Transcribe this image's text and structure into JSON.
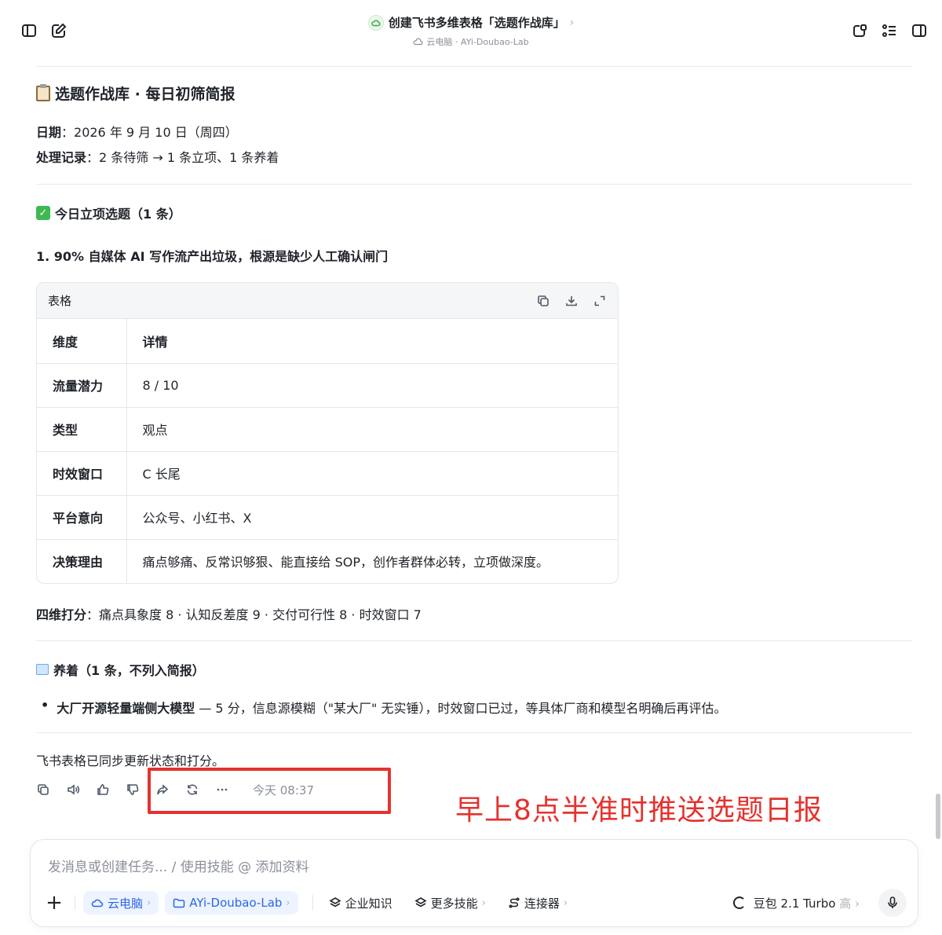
{
  "header": {
    "title": "创建飞书多维表格「选题作战库」",
    "title_chevron": "›",
    "subtitle": "云电脑 · AYi-Doubao-Lab"
  },
  "report": {
    "title": "选题作战库 · 每日初筛简报",
    "date_label": "日期",
    "date_value": "：2026 年 9 月 10 日（周四）",
    "record_label": "处理记录",
    "record_value": "：2 条待筛 → 1 条立项、1 条养着"
  },
  "approved": {
    "heading": "今日立项选题（1 条）",
    "item_title": "1. 90% 自媒体 AI 写作流产出垃圾，根源是缺少人工确认闸门",
    "table_label": "表格",
    "rows": [
      {
        "k": "维度",
        "v": "详情",
        "header": true
      },
      {
        "k": "流量潜力",
        "v": "8 / 10"
      },
      {
        "k": "类型",
        "v": "观点"
      },
      {
        "k": "时效窗口",
        "v": "C 长尾"
      },
      {
        "k": "平台意向",
        "v": "公众号、小红书、X"
      },
      {
        "k": "决策理由",
        "v": "痛点够痛、反常识够狠、能直接给 SOP，创作者群体必转，立项做深度。"
      }
    ],
    "score_label": "四维打分",
    "score_value": "：痛点具象度 8 · 认知反差度 9 · 交付可行性 8 · 时效窗口 7"
  },
  "incubating": {
    "heading": "养着（1 条，不列入简报）",
    "bullet_bold": "大厂开源轻量端侧大模型",
    "bullet_rest": " — 5 分，信息源模糊（\"某大厂\" 无实锤），时效窗口已过，等具体厂商和模型名明确后再评估。"
  },
  "footer_note": "飞书表格已同步更新状态和打分。",
  "actions": {
    "time": "今天 08:37"
  },
  "annotation": "早上8点半准时推送选题日报",
  "input": {
    "placeholder": "发消息或创建任务... / 使用技能 @ 添加资料",
    "chips": {
      "cloud": "云电脑",
      "lab": "AYi-Doubao-Lab",
      "knowledge": "企业知识",
      "skills": "更多技能",
      "connector": "连接器"
    },
    "model_name": "豆包 2.1 Turbo",
    "model_level": "高"
  },
  "colors": {
    "annotation_red": "#e5322d",
    "chip_blue": "#2b66e6",
    "check_green": "#3fb950"
  }
}
